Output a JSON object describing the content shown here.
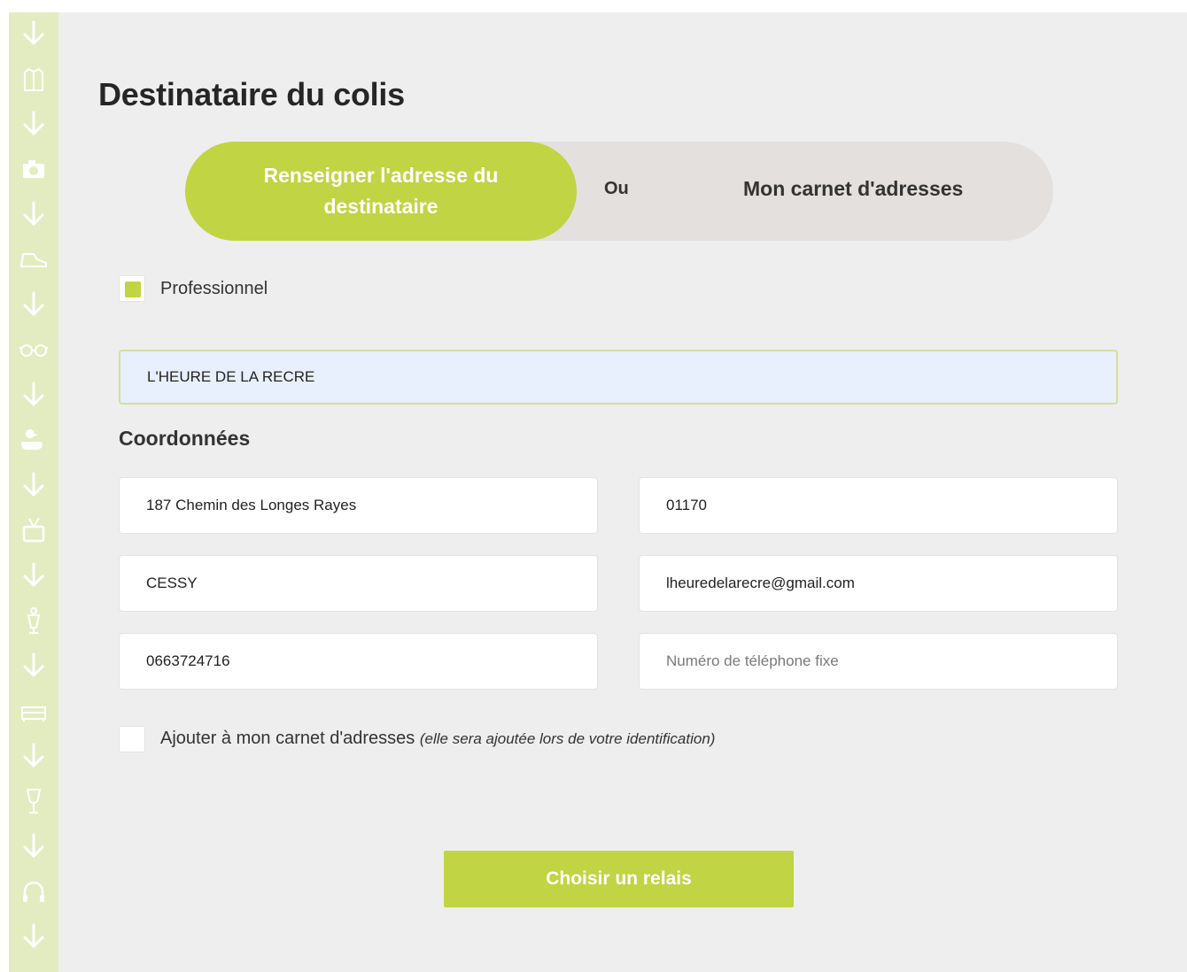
{
  "colors": {
    "accent": "#c1d443",
    "sidebar": "#e3ecc0",
    "background": "#eeeeee",
    "toggle_inactive": "#e3e0dd"
  },
  "sidebar": {
    "icons": [
      "arrow-down-icon",
      "clothing-icon",
      "arrow-down-icon",
      "camera-icon",
      "arrow-down-icon",
      "shoe-icon",
      "arrow-down-icon",
      "glasses-icon",
      "arrow-down-icon",
      "duck-icon",
      "arrow-down-icon",
      "tv-icon",
      "arrow-down-icon",
      "mannequin-icon",
      "arrow-down-icon",
      "sofa-icon",
      "arrow-down-icon",
      "wine-glass-icon",
      "arrow-down-icon",
      "headphones-icon",
      "arrow-down-icon",
      "lamp-icon"
    ]
  },
  "page": {
    "title": "Destinataire du colis"
  },
  "toggle": {
    "active_label": "Renseigner l'adresse du destinataire",
    "separator": "Ou",
    "inactive_label": "Mon carnet d'adresses"
  },
  "professional": {
    "label": "Professionnel",
    "checked": true
  },
  "form": {
    "company": "L'HEURE DE LA RECRE",
    "section_title": "Coordonnées",
    "address": "187 Chemin des Longes Rayes",
    "postal_code": "01170",
    "city": "CESSY",
    "email": "lheuredelarecre@gmail.com",
    "mobile": "0663724716",
    "landline_value": "",
    "landline_placeholder": "Numéro de téléphone fixe"
  },
  "address_book": {
    "label": "Ajouter à mon carnet d'adresses",
    "note": "(elle sera ajoutée lors de votre identification)",
    "checked": false
  },
  "submit": {
    "label": "Choisir un relais"
  }
}
